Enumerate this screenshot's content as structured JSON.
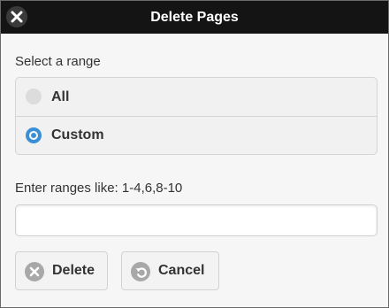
{
  "dialog": {
    "title": "Delete Pages",
    "close_icon": "close-icon"
  },
  "range": {
    "label": "Select a range",
    "options": [
      {
        "label": "All",
        "selected": false
      },
      {
        "label": "Custom",
        "selected": true
      }
    ]
  },
  "ranges": {
    "hint": "Enter ranges like: 1-4,6,8-10",
    "value": "",
    "placeholder": ""
  },
  "buttons": {
    "delete_label": "Delete",
    "delete_icon": "delete-x-icon",
    "cancel_label": "Cancel",
    "cancel_icon": "undo-icon"
  },
  "colors": {
    "titlebar": "#141414",
    "accent": "#3b8fd6",
    "icon_gray": "#a8a8a8"
  }
}
